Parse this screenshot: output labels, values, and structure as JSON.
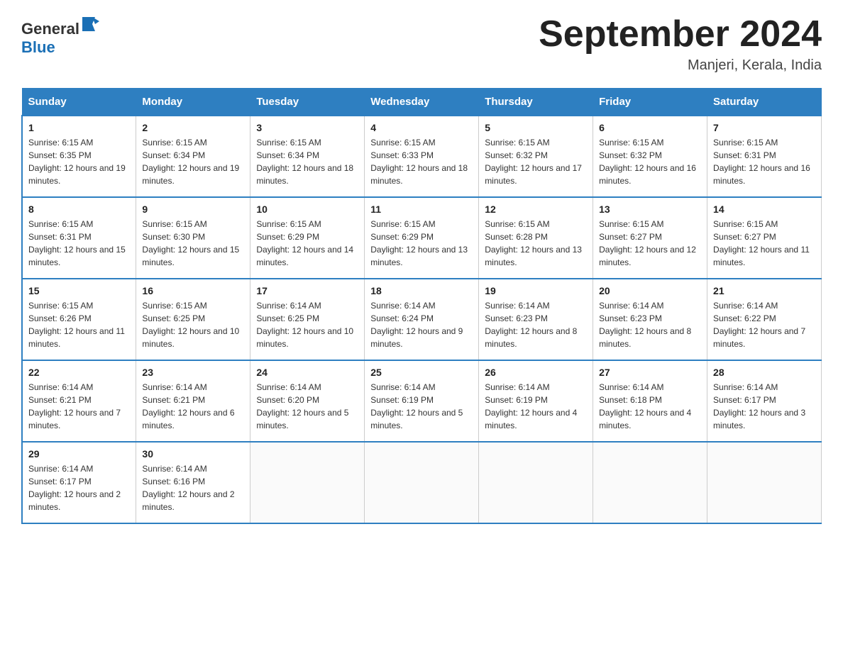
{
  "header": {
    "logo_general": "General",
    "logo_blue": "Blue",
    "month_title": "September 2024",
    "location": "Manjeri, Kerala, India"
  },
  "days_of_week": [
    "Sunday",
    "Monday",
    "Tuesday",
    "Wednesday",
    "Thursday",
    "Friday",
    "Saturday"
  ],
  "weeks": [
    [
      {
        "day": "1",
        "sunrise": "Sunrise: 6:15 AM",
        "sunset": "Sunset: 6:35 PM",
        "daylight": "Daylight: 12 hours and 19 minutes."
      },
      {
        "day": "2",
        "sunrise": "Sunrise: 6:15 AM",
        "sunset": "Sunset: 6:34 PM",
        "daylight": "Daylight: 12 hours and 19 minutes."
      },
      {
        "day": "3",
        "sunrise": "Sunrise: 6:15 AM",
        "sunset": "Sunset: 6:34 PM",
        "daylight": "Daylight: 12 hours and 18 minutes."
      },
      {
        "day": "4",
        "sunrise": "Sunrise: 6:15 AM",
        "sunset": "Sunset: 6:33 PM",
        "daylight": "Daylight: 12 hours and 18 minutes."
      },
      {
        "day": "5",
        "sunrise": "Sunrise: 6:15 AM",
        "sunset": "Sunset: 6:32 PM",
        "daylight": "Daylight: 12 hours and 17 minutes."
      },
      {
        "day": "6",
        "sunrise": "Sunrise: 6:15 AM",
        "sunset": "Sunset: 6:32 PM",
        "daylight": "Daylight: 12 hours and 16 minutes."
      },
      {
        "day": "7",
        "sunrise": "Sunrise: 6:15 AM",
        "sunset": "Sunset: 6:31 PM",
        "daylight": "Daylight: 12 hours and 16 minutes."
      }
    ],
    [
      {
        "day": "8",
        "sunrise": "Sunrise: 6:15 AM",
        "sunset": "Sunset: 6:31 PM",
        "daylight": "Daylight: 12 hours and 15 minutes."
      },
      {
        "day": "9",
        "sunrise": "Sunrise: 6:15 AM",
        "sunset": "Sunset: 6:30 PM",
        "daylight": "Daylight: 12 hours and 15 minutes."
      },
      {
        "day": "10",
        "sunrise": "Sunrise: 6:15 AM",
        "sunset": "Sunset: 6:29 PM",
        "daylight": "Daylight: 12 hours and 14 minutes."
      },
      {
        "day": "11",
        "sunrise": "Sunrise: 6:15 AM",
        "sunset": "Sunset: 6:29 PM",
        "daylight": "Daylight: 12 hours and 13 minutes."
      },
      {
        "day": "12",
        "sunrise": "Sunrise: 6:15 AM",
        "sunset": "Sunset: 6:28 PM",
        "daylight": "Daylight: 12 hours and 13 minutes."
      },
      {
        "day": "13",
        "sunrise": "Sunrise: 6:15 AM",
        "sunset": "Sunset: 6:27 PM",
        "daylight": "Daylight: 12 hours and 12 minutes."
      },
      {
        "day": "14",
        "sunrise": "Sunrise: 6:15 AM",
        "sunset": "Sunset: 6:27 PM",
        "daylight": "Daylight: 12 hours and 11 minutes."
      }
    ],
    [
      {
        "day": "15",
        "sunrise": "Sunrise: 6:15 AM",
        "sunset": "Sunset: 6:26 PM",
        "daylight": "Daylight: 12 hours and 11 minutes."
      },
      {
        "day": "16",
        "sunrise": "Sunrise: 6:15 AM",
        "sunset": "Sunset: 6:25 PM",
        "daylight": "Daylight: 12 hours and 10 minutes."
      },
      {
        "day": "17",
        "sunrise": "Sunrise: 6:14 AM",
        "sunset": "Sunset: 6:25 PM",
        "daylight": "Daylight: 12 hours and 10 minutes."
      },
      {
        "day": "18",
        "sunrise": "Sunrise: 6:14 AM",
        "sunset": "Sunset: 6:24 PM",
        "daylight": "Daylight: 12 hours and 9 minutes."
      },
      {
        "day": "19",
        "sunrise": "Sunrise: 6:14 AM",
        "sunset": "Sunset: 6:23 PM",
        "daylight": "Daylight: 12 hours and 8 minutes."
      },
      {
        "day": "20",
        "sunrise": "Sunrise: 6:14 AM",
        "sunset": "Sunset: 6:23 PM",
        "daylight": "Daylight: 12 hours and 8 minutes."
      },
      {
        "day": "21",
        "sunrise": "Sunrise: 6:14 AM",
        "sunset": "Sunset: 6:22 PM",
        "daylight": "Daylight: 12 hours and 7 minutes."
      }
    ],
    [
      {
        "day": "22",
        "sunrise": "Sunrise: 6:14 AM",
        "sunset": "Sunset: 6:21 PM",
        "daylight": "Daylight: 12 hours and 7 minutes."
      },
      {
        "day": "23",
        "sunrise": "Sunrise: 6:14 AM",
        "sunset": "Sunset: 6:21 PM",
        "daylight": "Daylight: 12 hours and 6 minutes."
      },
      {
        "day": "24",
        "sunrise": "Sunrise: 6:14 AM",
        "sunset": "Sunset: 6:20 PM",
        "daylight": "Daylight: 12 hours and 5 minutes."
      },
      {
        "day": "25",
        "sunrise": "Sunrise: 6:14 AM",
        "sunset": "Sunset: 6:19 PM",
        "daylight": "Daylight: 12 hours and 5 minutes."
      },
      {
        "day": "26",
        "sunrise": "Sunrise: 6:14 AM",
        "sunset": "Sunset: 6:19 PM",
        "daylight": "Daylight: 12 hours and 4 minutes."
      },
      {
        "day": "27",
        "sunrise": "Sunrise: 6:14 AM",
        "sunset": "Sunset: 6:18 PM",
        "daylight": "Daylight: 12 hours and 4 minutes."
      },
      {
        "day": "28",
        "sunrise": "Sunrise: 6:14 AM",
        "sunset": "Sunset: 6:17 PM",
        "daylight": "Daylight: 12 hours and 3 minutes."
      }
    ],
    [
      {
        "day": "29",
        "sunrise": "Sunrise: 6:14 AM",
        "sunset": "Sunset: 6:17 PM",
        "daylight": "Daylight: 12 hours and 2 minutes."
      },
      {
        "day": "30",
        "sunrise": "Sunrise: 6:14 AM",
        "sunset": "Sunset: 6:16 PM",
        "daylight": "Daylight: 12 hours and 2 minutes."
      },
      null,
      null,
      null,
      null,
      null
    ]
  ]
}
